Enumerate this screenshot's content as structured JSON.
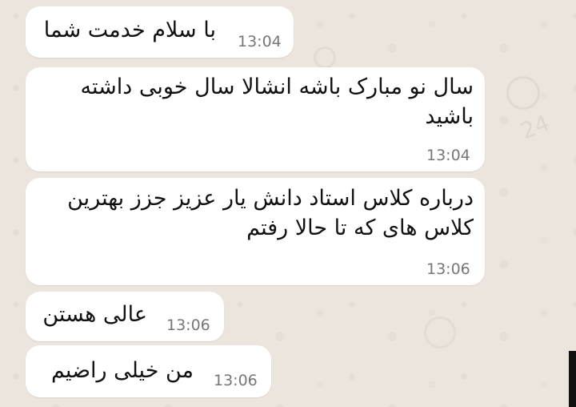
{
  "messages": [
    {
      "text": "با سلام خدمت شما",
      "time": "13:04"
    },
    {
      "text": "سال نو مبارک باشه انشالا سال خوبی داشته باشید",
      "time": "13:04"
    },
    {
      "text": "درباره کلاس استاد دانش یار عزیز جزز بهترین کلاس های که تا حالا رفتم",
      "time": "13:06"
    },
    {
      "text": "عالی هستن",
      "time": "13:06"
    },
    {
      "text": "من خیلی راضیم",
      "time": "13:06"
    }
  ],
  "background": {
    "doodle_number": "24"
  },
  "colors": {
    "chat_background": "#ece5dd",
    "bubble": "#ffffff",
    "timestamp": "#777777"
  }
}
